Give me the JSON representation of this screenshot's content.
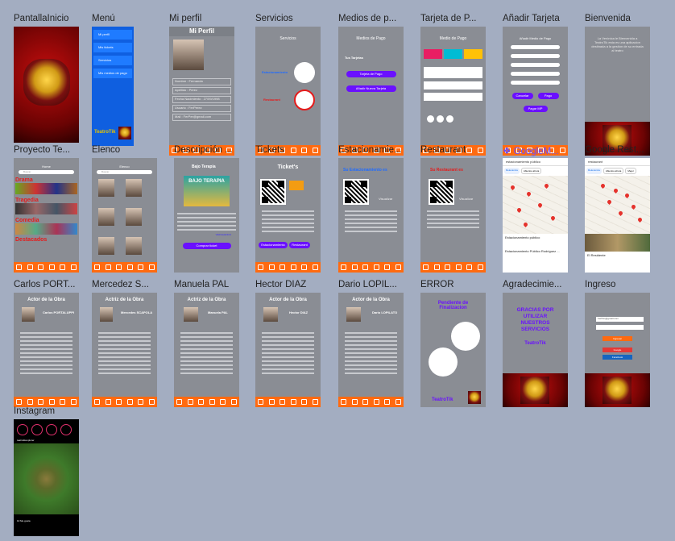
{
  "frames": {
    "pantalla_inicio": {
      "label": "PantallaInicio"
    },
    "menu": {
      "label": "Menú",
      "items": [
        "Mi perfil",
        "Mis tickets",
        "Servicios",
        "Mis medios de pago"
      ],
      "brand": "TeatroTik"
    },
    "mi_perfil": {
      "label": "Mi perfil",
      "title": "Mi Perfil",
      "fields": [
        "Nombre : Fernanda",
        "Apellido : Perez",
        "Fecha Nacimiento : 27/09/1998",
        "Usuario : FerPerez",
        "Mail : FerPer@gmail.com"
      ]
    },
    "servicios": {
      "label": "Servicios",
      "title": "Servicios",
      "items": [
        "Estacionamiento",
        "Restaurant"
      ]
    },
    "medios_pago": {
      "label": "Medios de p...",
      "title": "Medios de Pago",
      "subtitle": "Tus Tarjetas",
      "buttons": [
        "Tarjeta de Pago",
        "Añadir Nueva Tarjeta"
      ]
    },
    "tarjeta_pago": {
      "label": "Tarjeta de P...",
      "title": "Medio de Pago"
    },
    "anadir_tarjeta": {
      "label": "Añadir Tarjeta",
      "title": "Añadir Medio de Pago",
      "buttons": [
        "Cancelar",
        "Pago",
        "Pagar MP"
      ]
    },
    "bienvenida": {
      "label": "Bienvenida",
      "text": "La Verónica le Bienvenida a TeatroTik esta es una aplicacion destinada a la gestion de su entrada al teatro"
    },
    "proyecto_teatro": {
      "label": "Proyecto Te...",
      "title": "Home",
      "search_placeholder": "Buscar",
      "sections": [
        "Drama",
        "Tragedia",
        "Comedia",
        "Destacados"
      ]
    },
    "elenco": {
      "label": "Elenco",
      "title": "Elenco",
      "search_placeholder": "Buscar"
    },
    "descripcion": {
      "label": "Descripción ...",
      "title": "Bajo Terapia",
      "poster": "BAJO TERAPIA",
      "button": "Comprar ticket",
      "link": "VER ELENCO"
    },
    "tickets": {
      "label": "Tickets",
      "title": "Ticket's",
      "buttons": [
        "Estacionamiento",
        "Restaurant"
      ]
    },
    "estacionamiento": {
      "label": "Estacionamie...",
      "title": "Su Estacionamiento es",
      "action": "Visualizar"
    },
    "restaurant": {
      "label": "Restaurant",
      "title": "Su Restaurant es",
      "action": "Visualizar"
    },
    "google_maps": {
      "label": "GoogleM...",
      "search": "estacionamiento público",
      "chips": [
        "Relevancia",
        "Abiertos ahora"
      ],
      "result1": "Estacionamiento público",
      "result2": "Estacionamiento Público Rodriguez ..."
    },
    "google_rest": {
      "label": "Google Rest...",
      "search": "restaurant",
      "chips": [
        "Relevancia",
        "Abiertos ahora",
        "Mejor"
      ],
      "result": "El Residente"
    },
    "carlos": {
      "label": "Carlos PORT...",
      "title": "Actor de la Obra",
      "name": "Carlos PORTALUPPI"
    },
    "mercedez": {
      "label": "Mercedez S...",
      "title": "Actriz de la Obra",
      "name": "Mercedes SCAPOLA"
    },
    "manuela": {
      "label": "Manuela PAL",
      "title": "Actriz de la Obra",
      "name": "Manuela PAL"
    },
    "hector": {
      "label": "Hector DIAZ",
      "title": "Actor de la Obra",
      "name": "Hector DIAZ"
    },
    "dario": {
      "label": "Dario LOPIL...",
      "title": "Actor de la Obra",
      "name": "Dario LOPILATO"
    },
    "error": {
      "label": "ERROR",
      "title": "Pendiente de Finalizacion",
      "brand": "TeatroTik"
    },
    "agradecimiento": {
      "label": "Agradecimie...",
      "text": "GRACIAS POR UTILIZAR NUESTROS SERVICIOS",
      "brand": "TeatroTik"
    },
    "ingreso": {
      "label": "Ingreso",
      "user": "FerPer@gmail.com",
      "buttons": [
        "Ingresar",
        "Google",
        "Facebook"
      ]
    },
    "instagram": {
      "label": "Instagram",
      "handle": "teatrotikexplorer",
      "likes": "10 Me gusta"
    }
  },
  "colors": {
    "canvas": "#a3adc1",
    "accent_orange": "#ff6a10",
    "accent_purple": "#6a10ff",
    "phone_gray": "#8a8d94"
  }
}
